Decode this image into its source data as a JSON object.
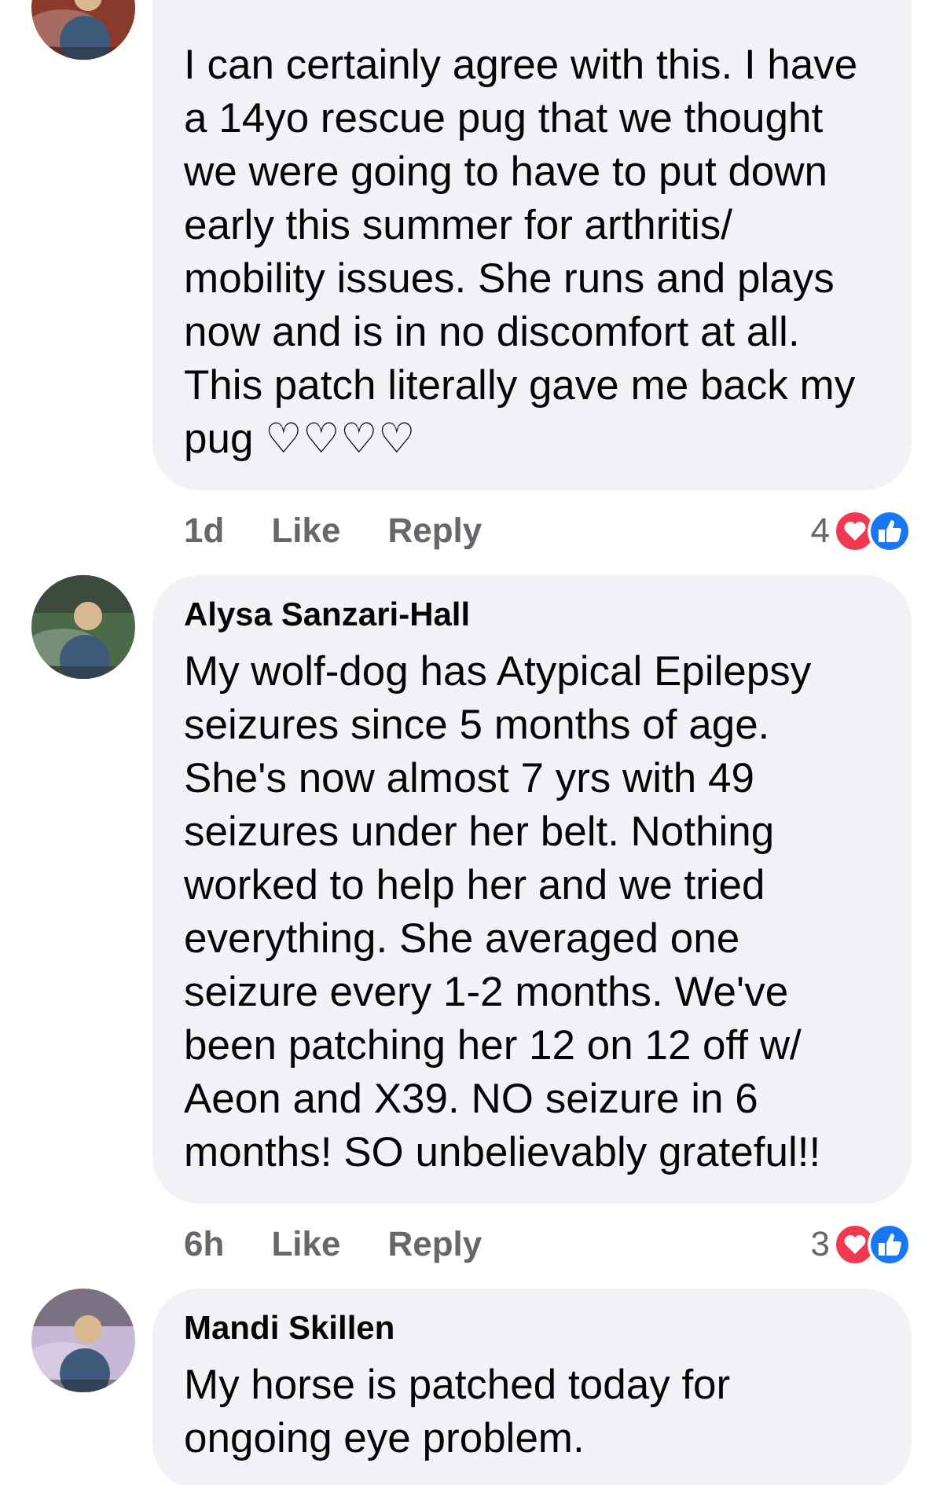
{
  "comments": [
    {
      "text": "I can certainly agree with this. I have a 14yo rescue pug that we thought we were going to have to put down early this summer for arthritis/ mobility issues. She runs and plays now and is in no discomfort at all. This patch literally gave me back my pug ♡♡♡♡",
      "time": "1d",
      "like": "Like",
      "reply": "Reply",
      "reaction_count": "4"
    },
    {
      "author": "Alysa Sanzari-Hall",
      "text": "My wolf-dog has Atypical Epilepsy seizures since 5 months of age. She's now almost 7 yrs with 49 seizures under her belt. Nothing worked to help her and we tried everything. She averaged one seizure every 1-2 months. We've been patching her 12 on 12 off w/ Aeon and X39. NO seizure in 6 months! SO unbelievably  grateful!!",
      "time": "6h",
      "like": "Like",
      "reply": "Reply",
      "reaction_count": "3"
    },
    {
      "author": "Mandi Skillen",
      "text": "My horse is patched today for ongoing eye problem."
    }
  ]
}
